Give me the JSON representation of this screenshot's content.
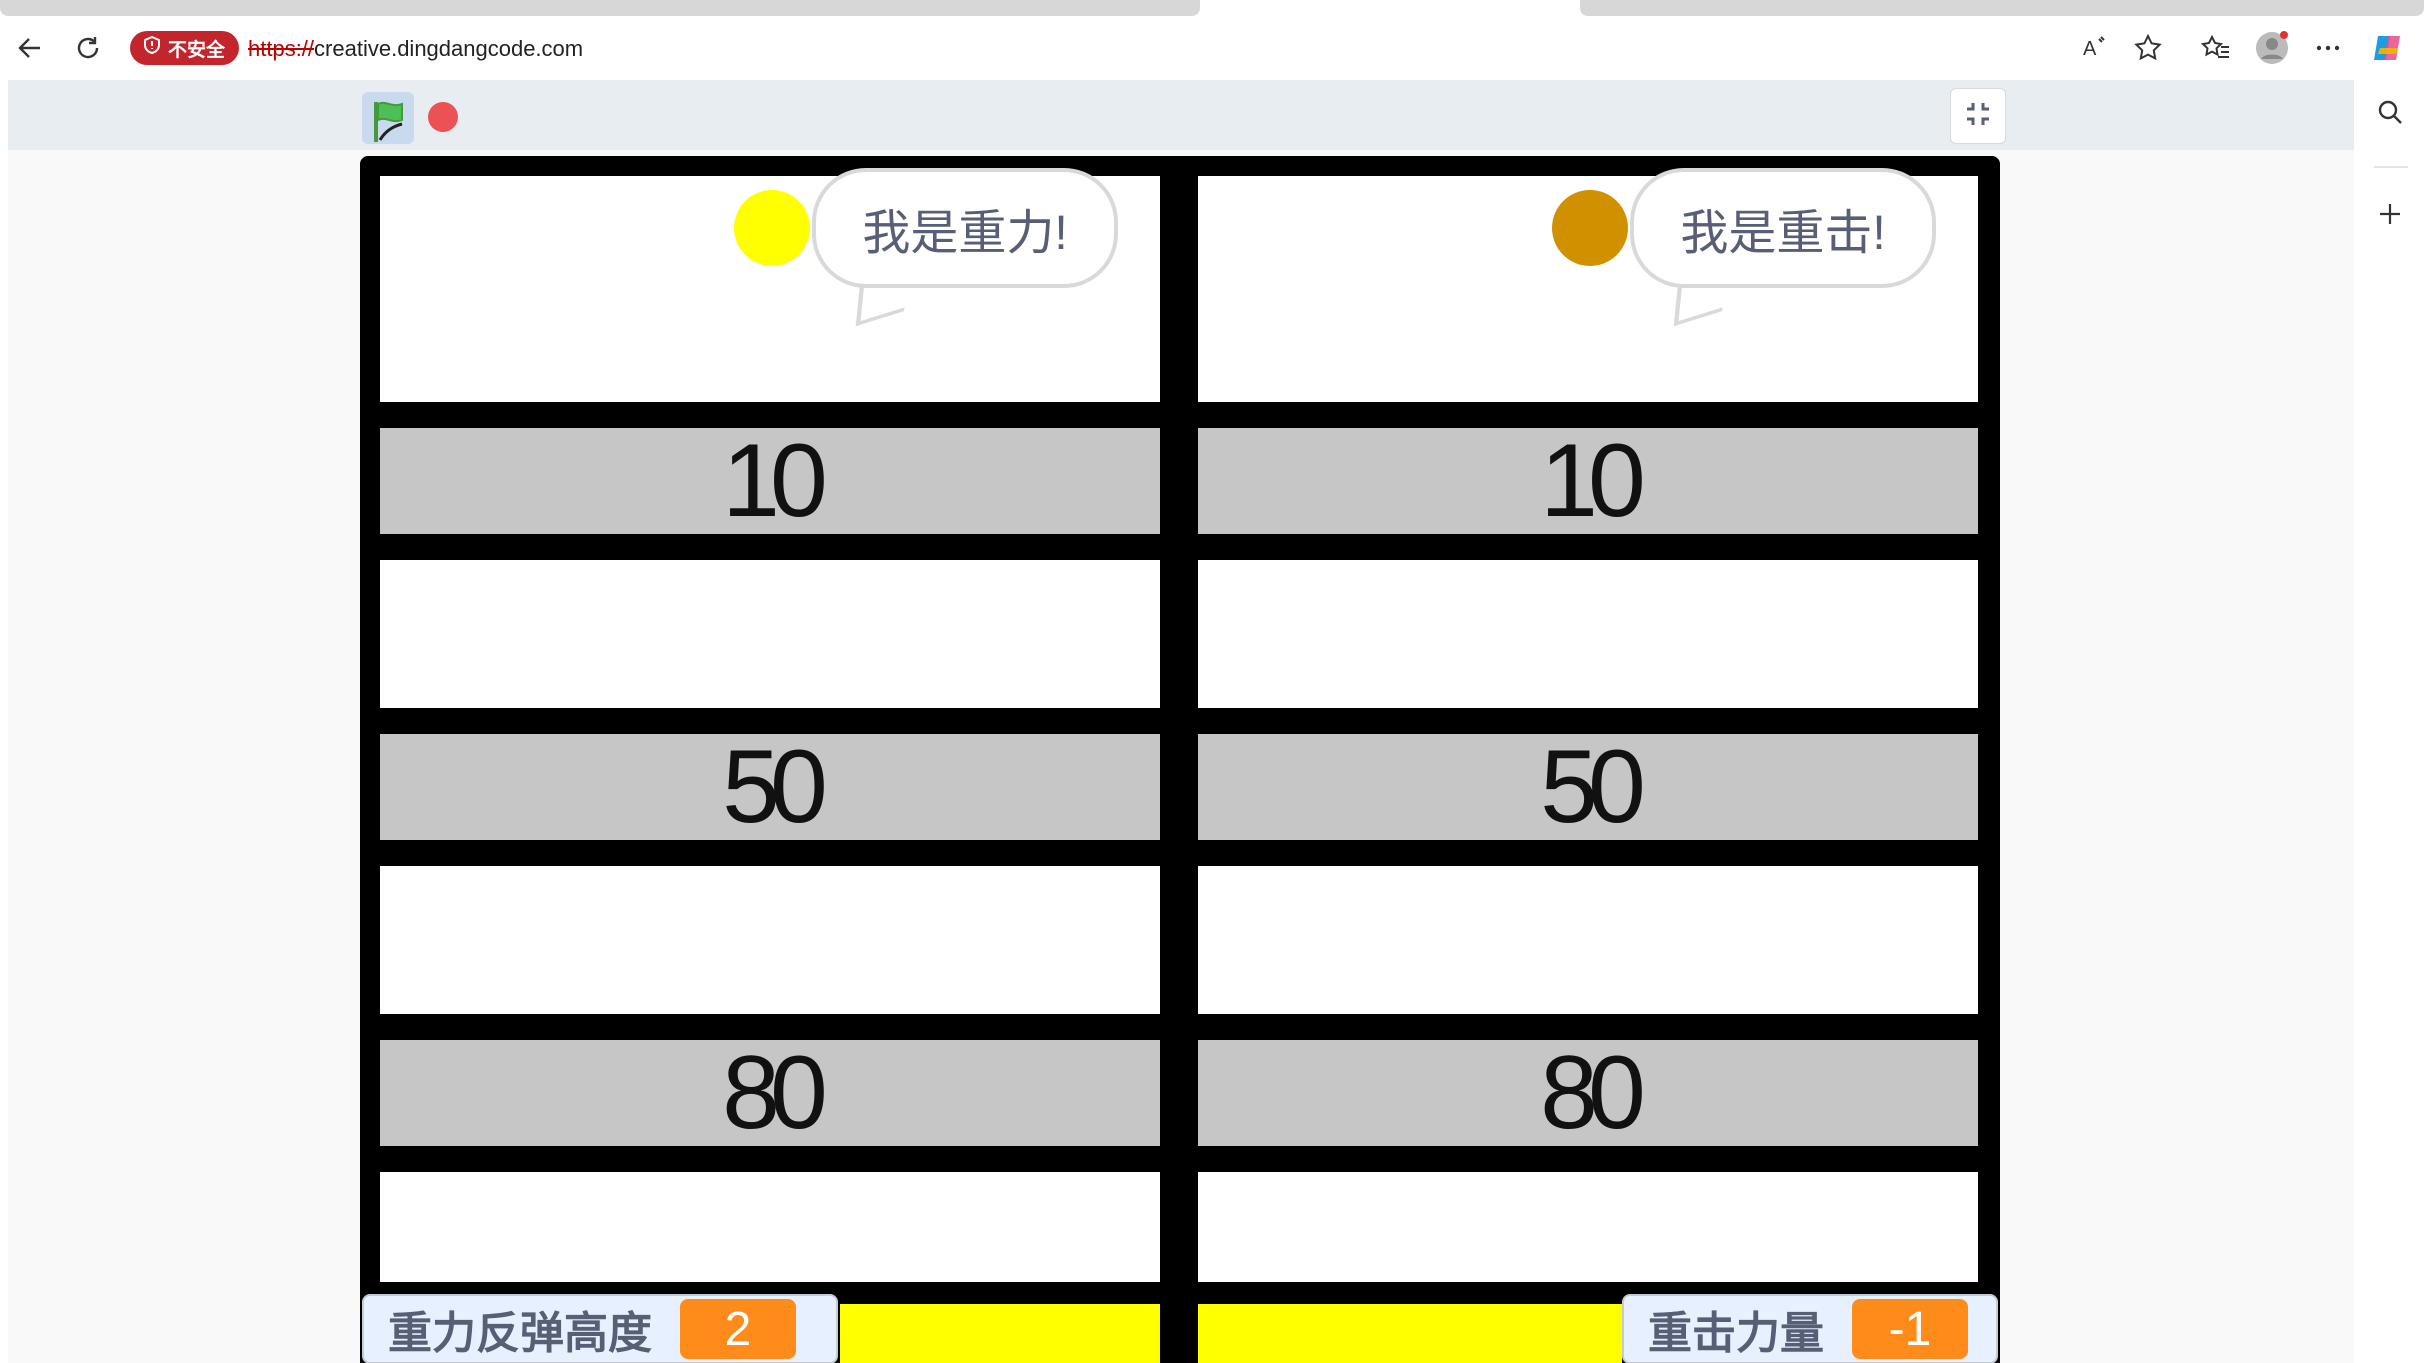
{
  "browser": {
    "security_label": "不安全",
    "url_protocol": "https://",
    "url_host": "creative.dingdangcode.com"
  },
  "icons": [
    "back-arrow-icon",
    "refresh-icon",
    "shield-icon",
    "read-aloud-icon",
    "star-icon",
    "favorites-icon",
    "profile-icon",
    "more-icon",
    "copilot-icon",
    "search-icon",
    "plus-icon",
    "green-flag-icon",
    "stop-icon",
    "fullscreen-exit-icon"
  ],
  "colors": {
    "ball_left": "#ffff00",
    "ball_right": "#d09000",
    "bar_gray": "#c6c6c6",
    "stage_bg": "#000000",
    "monitor_value": "#ff8c1a"
  },
  "stage": {
    "left": {
      "speech": "我是重力!",
      "rows": [
        "10",
        "50",
        "80"
      ],
      "monitor_label": "重力反弹高度",
      "monitor_value": "2"
    },
    "right": {
      "speech": "我是重击!",
      "rows": [
        "10",
        "50",
        "80"
      ],
      "monitor_label": "重击力量",
      "monitor_value": "-1"
    }
  }
}
